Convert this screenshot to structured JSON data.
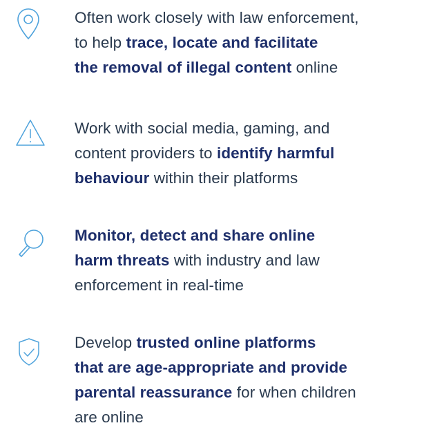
{
  "items": [
    {
      "icon": "location-pin-icon",
      "lines": [
        [
          {
            "text": "Often work closely with law enforcement,",
            "bold": false
          }
        ],
        [
          {
            "text": "to help ",
            "bold": false
          },
          {
            "text": "trace, locate and facilitate",
            "bold": true
          }
        ],
        [
          {
            "text": "the removal of illegal content",
            "bold": true
          },
          {
            "text": " online",
            "bold": false
          }
        ]
      ]
    },
    {
      "icon": "warning-triangle-icon",
      "lines": [
        [
          {
            "text": "Work with social media, gaming, and",
            "bold": false
          }
        ],
        [
          {
            "text": "content providers to ",
            "bold": false
          },
          {
            "text": "identify harmful",
            "bold": true
          }
        ],
        [
          {
            "text": "behaviour",
            "bold": true
          },
          {
            "text": " within their platforms",
            "bold": false
          }
        ]
      ]
    },
    {
      "icon": "magnifier-icon",
      "lines": [
        [
          {
            "text": "Monitor, detect and share online",
            "bold": true
          }
        ],
        [
          {
            "text": "harm threats",
            "bold": true
          },
          {
            "text": " with industry and law",
            "bold": false
          }
        ],
        [
          {
            "text": "enforcement in real-time",
            "bold": false
          }
        ]
      ]
    },
    {
      "icon": "shield-check-icon",
      "lines": [
        [
          {
            "text": "Develop ",
            "bold": false
          },
          {
            "text": "trusted online platforms",
            "bold": true
          }
        ],
        [
          {
            "text": "that are age-appropriate and provide",
            "bold": true
          }
        ],
        [
          {
            "text": "parental reassurance",
            "bold": true
          },
          {
            "text": " for when children",
            "bold": false
          }
        ],
        [
          {
            "text": "are online",
            "bold": false
          }
        ]
      ]
    }
  ],
  "colors": {
    "icon_stroke": "#4fa3dc",
    "text": "#2a3a4e",
    "bold_text": "#1e2f6b",
    "background": "#ffffff"
  }
}
